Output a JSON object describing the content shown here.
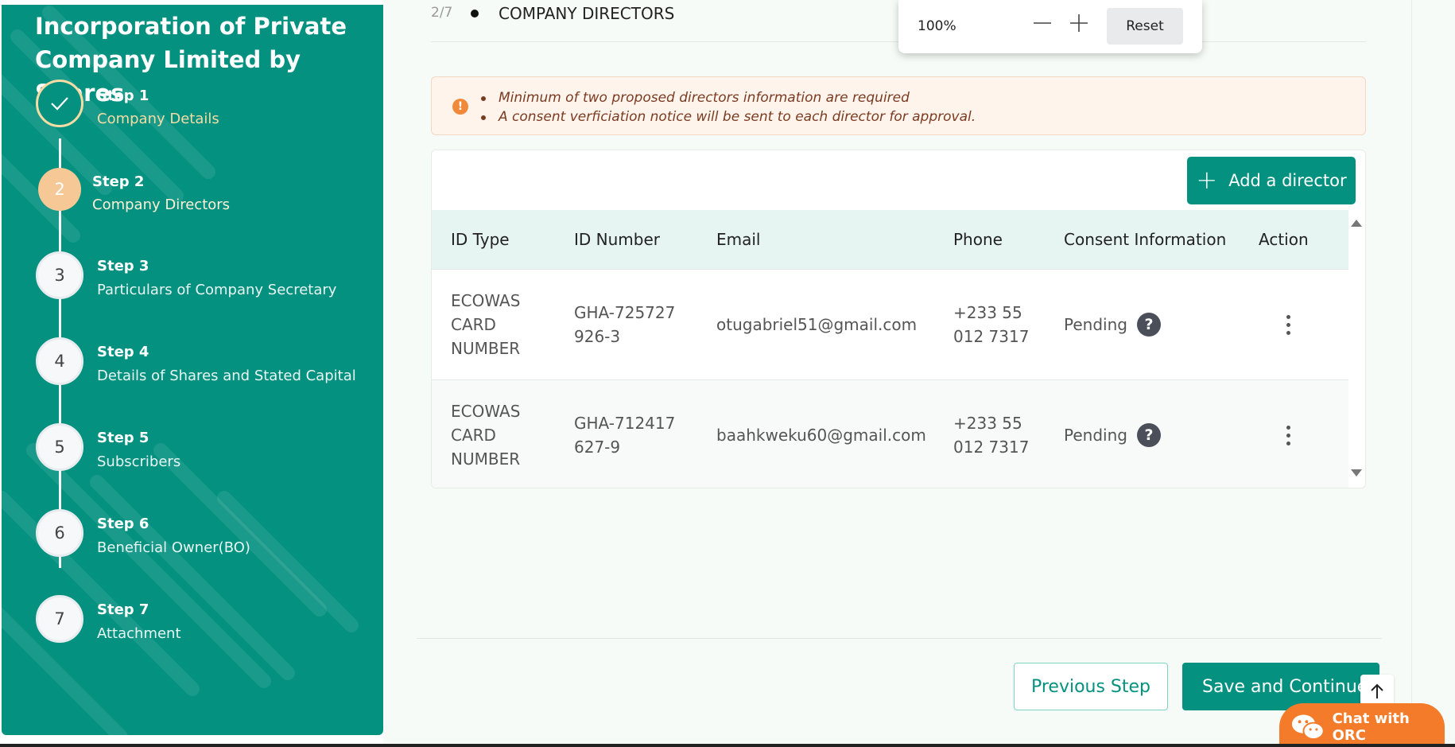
{
  "sidebar": {
    "title": "Incorporation of Private Company Limited by Shares",
    "steps": [
      {
        "number": "1",
        "label": "Step 1",
        "name": "Company Details",
        "state": "done"
      },
      {
        "number": "2",
        "label": "Step 2",
        "name": "Company Directors",
        "state": "active"
      },
      {
        "number": "3",
        "label": "Step 3",
        "name": "Particulars of Company Secretary",
        "state": "pending"
      },
      {
        "number": "4",
        "label": "Step 4",
        "name": "Details of Shares and Stated Capital",
        "state": "pending"
      },
      {
        "number": "5",
        "label": "Step 5",
        "name": "Subscribers",
        "state": "pending"
      },
      {
        "number": "6",
        "label": "Step 6",
        "name": "Beneficial Owner(BO)",
        "state": "pending"
      },
      {
        "number": "7",
        "label": "Step 7",
        "name": "Attachment",
        "state": "pending"
      }
    ]
  },
  "header": {
    "progress": "2/7",
    "section_title": "COMPANY DIRECTORS"
  },
  "zoom": {
    "value": "100%",
    "reset_label": "Reset"
  },
  "notice": {
    "items": [
      "Minimum of two proposed directors information are required",
      "A consent verficiation notice will be sent to each director for approval."
    ]
  },
  "directors": {
    "add_label": "Add a director",
    "columns": [
      "ID Type",
      "ID Number",
      "Email",
      "Phone",
      "Consent Information",
      "Action"
    ],
    "rows": [
      {
        "id_type": "ECOWAS CARD NUMBER",
        "id_number": "GHA-725727926-3",
        "email": "otugabriel51@gmail.com",
        "phone": "+233 55 012 7317",
        "consent": "Pending"
      },
      {
        "id_type": "ECOWAS CARD NUMBER",
        "id_number": "GHA-712417627-9",
        "email": "baahkweku60@gmail.com",
        "phone": "+233 55 012 7317",
        "consent": "Pending"
      }
    ]
  },
  "footer": {
    "previous_label": "Previous Step",
    "save_label": "Save and Continue",
    "chat_label": "Chat with ORC"
  },
  "colors": {
    "primary": "#04917f",
    "active_step": "#f5c895",
    "notice_bg": "#fff4eb",
    "chat": "#f47b2a"
  }
}
